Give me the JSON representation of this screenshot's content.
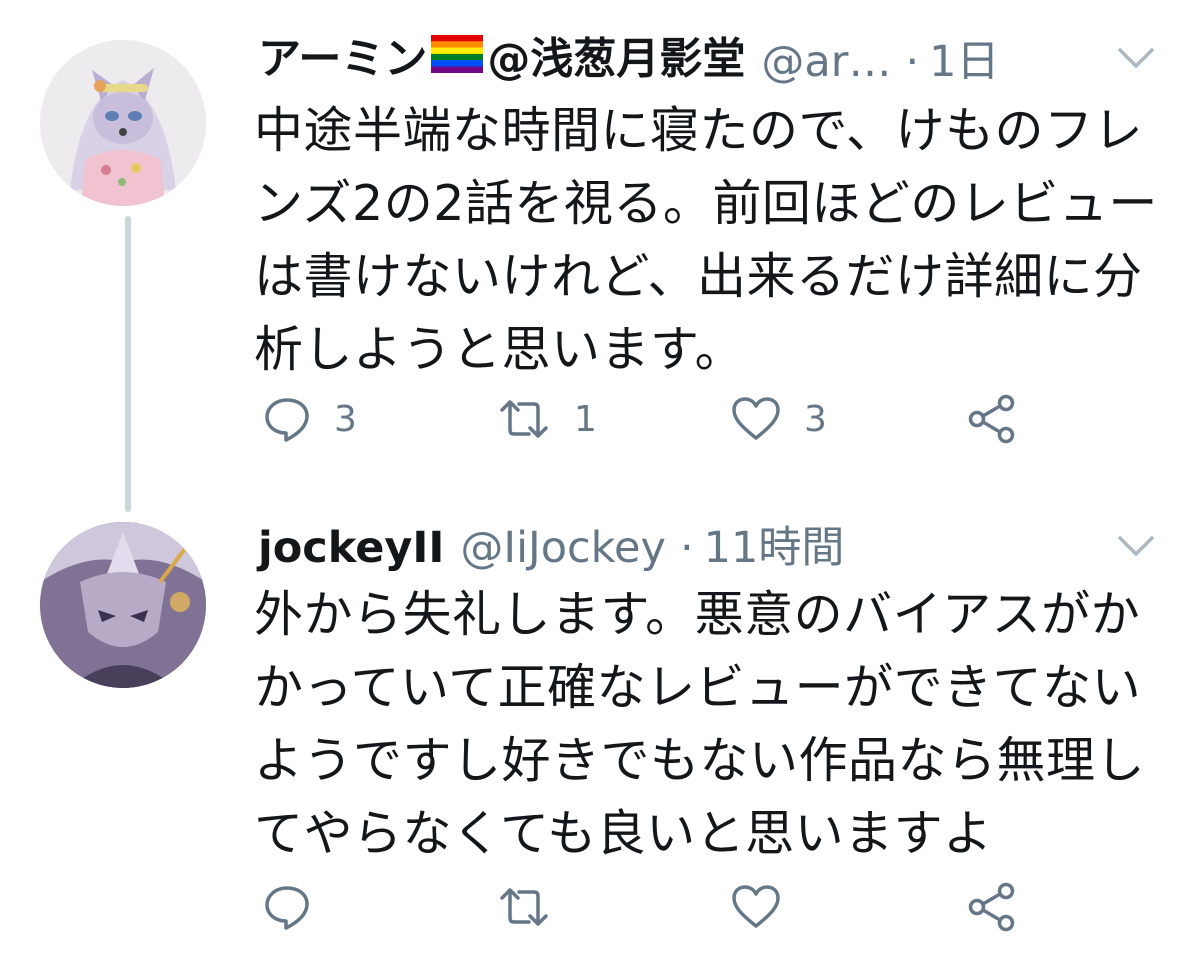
{
  "tweets": [
    {
      "display_name": "アーミン",
      "display_name_suffix": "@浅葱月影堂",
      "handle": "@ar…",
      "separator": "·",
      "time": "1日",
      "lines": [
        "中途半端な時間に寝たので、けものフレ",
        "ンズ2の2話を視る。前回ほどのレビュー",
        "は書けないけれど、出来るだけ詳細に分",
        "析しようと思います。"
      ],
      "replies": "3",
      "retweets": "1",
      "likes": "3"
    },
    {
      "display_name": "jockeyII",
      "handle": "@IiJockey",
      "separator": "·",
      "time": "11時間",
      "lines": [
        "外から失礼します。悪意のバイアスがか",
        "かっていて正確なレビューができてない",
        "ようですし好きでもない作品なら無理し",
        "てやらなくても良いと思いますよ"
      ]
    }
  ],
  "icons": {
    "reply": "reply-icon",
    "retweet": "retweet-icon",
    "like": "heart-icon",
    "share": "share-icon",
    "menu": "chevron-down-icon",
    "flag": "rainbow-flag-icon"
  },
  "colors": {
    "icon": "#657786",
    "text": "#14171a",
    "secondary": "#657786",
    "thread_line": "#ccd6dd"
  }
}
